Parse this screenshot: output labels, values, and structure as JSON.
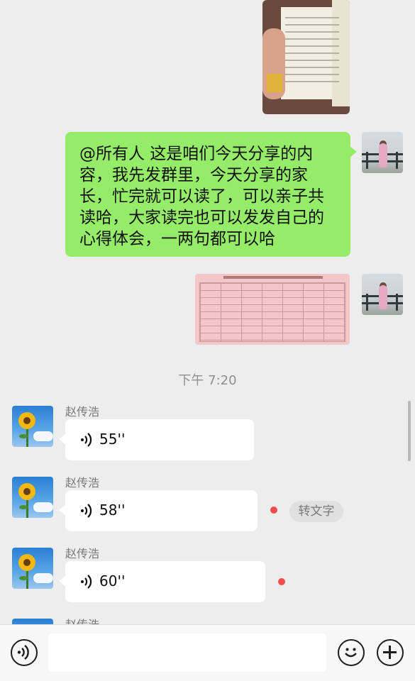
{
  "messages": {
    "text_message": "@所有人 这是咱们今天分享的内容，我先发群里，今天分享的家长，忙完就可以读了，可以亲子共读哈，大家读完也可以发发自己的心得体会，一两句都可以哈",
    "timestamp": "下午 7:20",
    "voice_messages": [
      {
        "sender": "赵传浩",
        "duration": "55''"
      },
      {
        "sender": "赵传浩",
        "duration": "58''"
      },
      {
        "sender": "赵传浩",
        "duration": "60''"
      },
      {
        "sender": "赵传浩"
      }
    ],
    "transcribe_label": "转文字"
  },
  "icons": {
    "voice_toggle": "voice-input-icon",
    "emoji": "emoji-icon",
    "add": "plus-icon",
    "voice_wave": "voice-wave-icon"
  },
  "colors": {
    "sent_bubble": "#95ec69",
    "received_bubble": "#ffffff",
    "unread_dot": "#f24c4c",
    "background": "#ededed"
  }
}
